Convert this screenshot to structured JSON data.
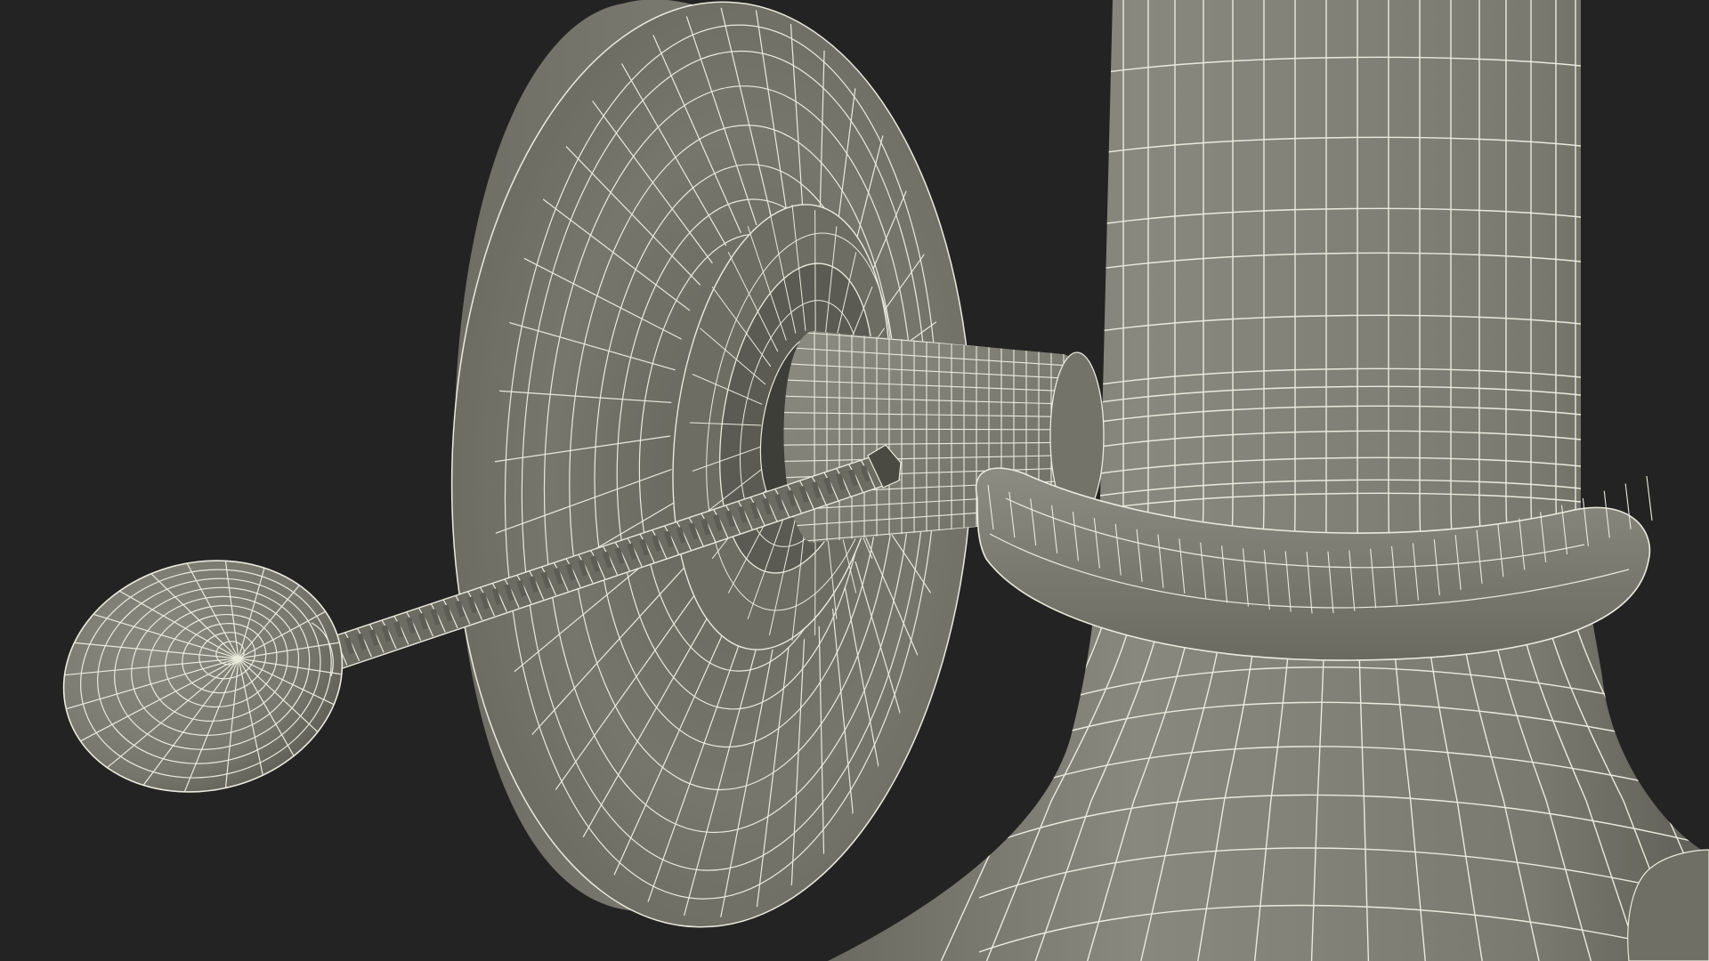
{
  "scene": {
    "background_color": "#232323",
    "surface_color": "#7d7d73",
    "surface_shadow_color": "#55554d",
    "surface_dark_color": "#3d3d37",
    "wire_color": "#eaeadd"
  }
}
